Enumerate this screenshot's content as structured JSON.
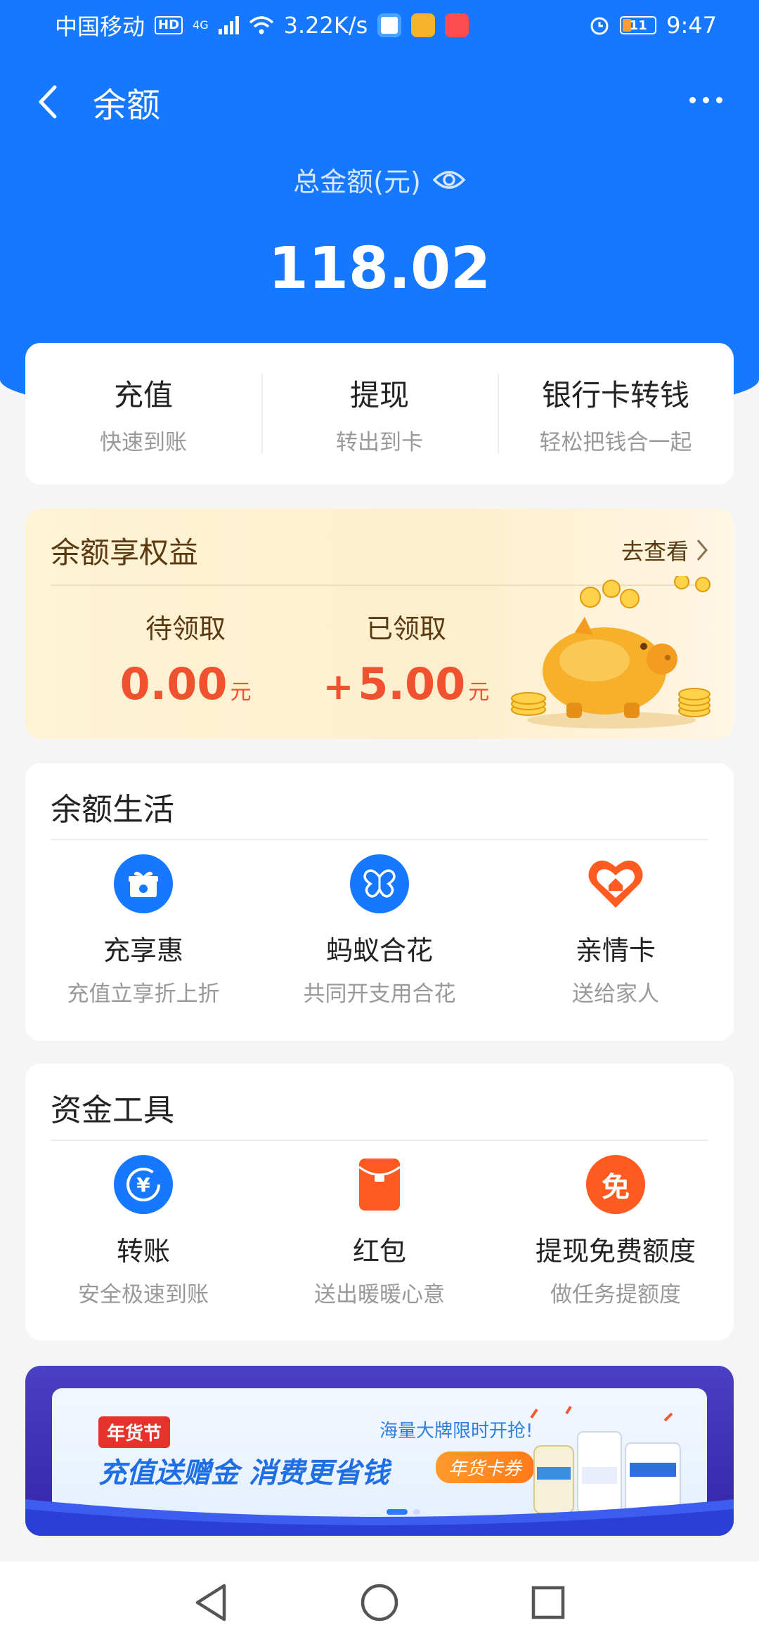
{
  "status_bar": {
    "carrier": "中国移动",
    "hd": "HD",
    "net": "4G",
    "speed": "3.22K/s",
    "battery": "11",
    "time": "9:47"
  },
  "nav": {
    "title": "余额",
    "back_icon": "chevron-left-icon",
    "more_icon": "more-icon"
  },
  "balance": {
    "label": "总金额(元)",
    "amount": "118.02",
    "eye_icon": "eye-icon"
  },
  "actions": [
    {
      "title": "充值",
      "sub": "快速到账"
    },
    {
      "title": "提现",
      "sub": "转出到卡"
    },
    {
      "title": "银行卡转钱",
      "sub": "轻松把钱合一起"
    }
  ],
  "benefits": {
    "title": "余额享权益",
    "link": "去查看",
    "pending_label": "待领取",
    "pending_value": "0.00",
    "received_label": "已领取",
    "received_sign": "+",
    "received_value": "5.00",
    "unit": "元"
  },
  "life": {
    "title": "余额生活",
    "items": [
      {
        "title": "充享惠",
        "sub": "充值立享折上折",
        "icon": "gift-icon"
      },
      {
        "title": "蚂蚁合花",
        "sub": "共同开支用合花",
        "icon": "butterfly-icon"
      },
      {
        "title": "亲情卡",
        "sub": "送给家人",
        "icon": "heart-home-icon"
      }
    ]
  },
  "tools": {
    "title": "资金工具",
    "items": [
      {
        "title": "转账",
        "sub": "安全极速到账",
        "icon": "yuan-transfer-icon"
      },
      {
        "title": "红包",
        "sub": "送出暖暖心意",
        "icon": "red-envelope-icon"
      },
      {
        "title": "提现免费额度",
        "sub": "做任务提额度",
        "icon": "free-icon",
        "icon_text": "免"
      }
    ]
  },
  "banner": {
    "tag": "年货节",
    "subtitle": "海量大牌限时开抢!",
    "headline": "充值送赠金  消费更省钱",
    "chip": "年货卡券"
  },
  "colors": {
    "primary": "#1677ff",
    "accent_red": "#f0512f",
    "orange": "#ff5a1f",
    "gold_text": "#5a3a12"
  }
}
